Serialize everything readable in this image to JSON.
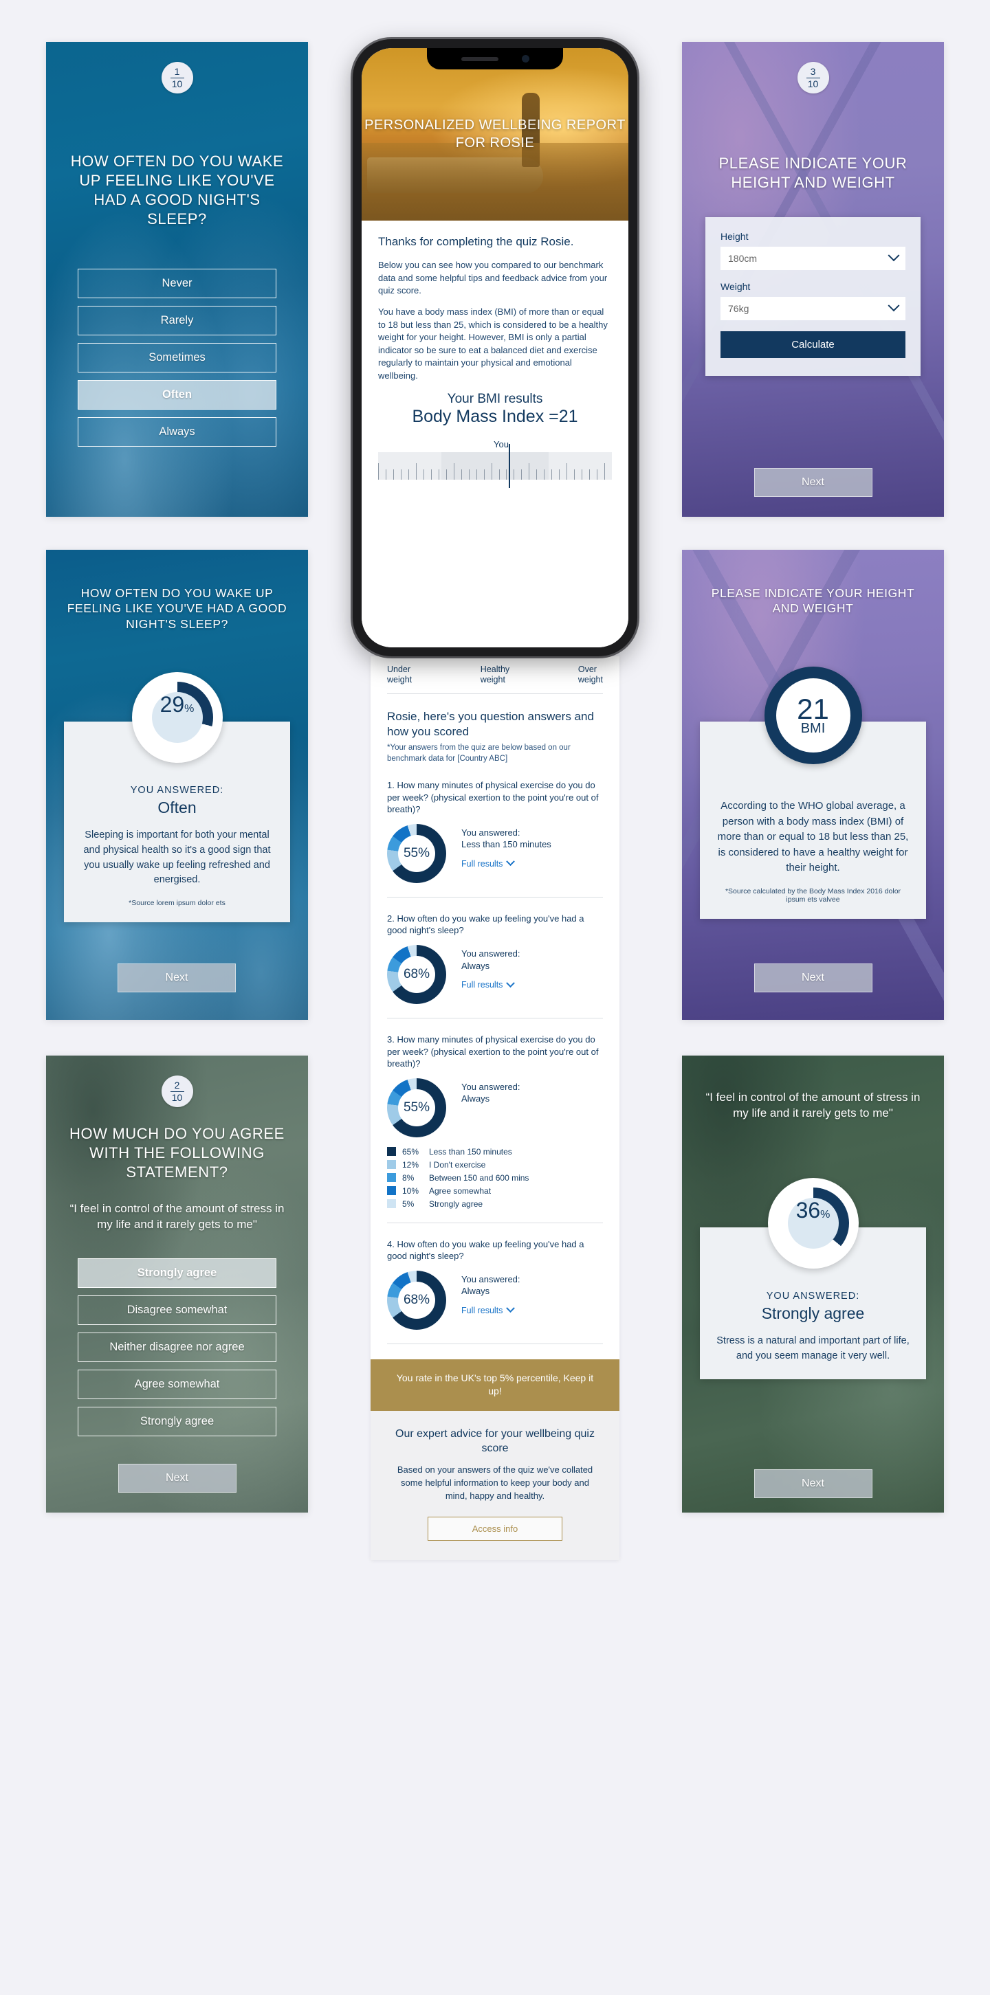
{
  "panels": {
    "q1": {
      "step_num": "1",
      "step_den": "10",
      "title": "HOW OFTEN DO YOU WAKE UP FEELING LIKE YOU'VE HAD A GOOD NIGHT'S SLEEP?",
      "options": [
        "Never",
        "Rarely",
        "Sometimes",
        "Often",
        "Always"
      ],
      "selected": "Often"
    },
    "q1_result": {
      "title": "HOW OFTEN DO YOU WAKE UP FEELING LIKE YOU'VE HAD A GOOD NIGHT'S SLEEP?",
      "percent": "29",
      "percent_symbol": "%",
      "answered_label": "YOU ANSWERED:",
      "answered_value": "Often",
      "body": "Sleeping is important for both your mental and physical health so it's a good sign that you usually wake up feeling refreshed and energised.",
      "source": "*Source lorem ipsum dolor ets",
      "next_label": "Next"
    },
    "q2": {
      "step_num": "2",
      "step_den": "10",
      "title": "HOW MUCH DO YOU AGREE WITH THE FOLLOWING STATEMENT?",
      "statement": "“I feel in control of the amount of stress in my life and it rarely gets to me\"",
      "options": [
        "Strongly agree",
        "Disagree somewhat",
        "Neither disagree nor agree",
        "Agree somewhat",
        "Strongly agree"
      ],
      "selected": "Strongly agree",
      "next_label": "Next"
    },
    "q3": {
      "step_num": "3",
      "step_den": "10",
      "title": "PLEASE INDICATE YOUR HEIGHT AND WEIGHT",
      "height_label": "Height",
      "height_value": "180cm",
      "weight_label": "Weight",
      "weight_value": "76kg",
      "calculate_label": "Calculate",
      "next_label": "Next"
    },
    "q3_result": {
      "title": "PLEASE INDICATE YOUR HEIGHT AND WEIGHT",
      "bmi_value": "21",
      "bmi_label": "BMI",
      "body": "According to the WHO global average, a person with a body mass index (BMI) of more than or equal to 18 but less than 25, is considered to have a healthy weight for their height.",
      "source": "*Source calculated by the Body Mass Index 2016 dolor ipsum ets valvee",
      "next_label": "Next"
    },
    "q2_result": {
      "statement": "“I feel in control of the amount of stress in my life and it rarely gets to me\"",
      "percent": "36",
      "percent_symbol": "%",
      "answered_label": "YOU ANSWERED:",
      "answered_value": "Strongly agree",
      "body": "Stress is a natural and important part of life, and you seem manage it very well.",
      "next_label": "Next"
    }
  },
  "phone": {
    "hero_title": "PERSONALIZED WELLBEING REPORT FOR ROSIE",
    "greeting": "Thanks for completing the quiz Rosie.",
    "para1": "Below you can see how you compared to our benchmark data and some helpful tips and feedback advice from your quiz score.",
    "para2": "You have a body mass index (BMI) of more than or equal to 18 but less than 25, which is considered to be a healthy weight for your height. However, BMI is only a partial indicator so be sure to eat a balanced diet and exercise regularly to maintain your physical and emotional wellbeing.",
    "bmi_head_1": "Your BMI results",
    "bmi_head_2": "Body Mass Index =21",
    "you_marker": "You",
    "scale_labels": [
      "Under weight",
      "Healthy weight",
      "Over weight"
    ],
    "section_head": "Rosie, here's you question answers and how you scored",
    "section_sub": "*Your answers from the quiz are below based on our benchmark data for [Country ABC]",
    "full_results_label": "Full results",
    "questions": [
      {
        "text": "1. How many minutes of physical exercise do you do per week? (physical exertion to the point you're out of breath)?",
        "percent": "55%",
        "answer_label": "You answered:",
        "answer_value": "Less than 150 minutes",
        "has_legend": false
      },
      {
        "text": "2. How often do you wake up feeling you've had a good night's sleep?",
        "percent": "68%",
        "answer_label": "You answered:",
        "answer_value": "Always",
        "has_legend": false
      },
      {
        "text": "3. How many minutes of physical exercise do you do per week? (physical exertion to the point you're out of breath)?",
        "percent": "55%",
        "answer_label": "You answered:",
        "answer_value": "Always",
        "has_legend": true
      },
      {
        "text": "4. How often do you wake up feeling you've had a good night's sleep?",
        "percent": "68%",
        "answer_label": "You answered:",
        "answer_value": "Always",
        "has_legend": false
      }
    ],
    "percentile_band": "You rate in the UK's top 5% percentile, Keep it up!",
    "advice_head": "Our expert advice for your wellbeing quiz score",
    "advice_body": "Based on your answers of the quiz we've collated some helpful information to keep your body and mind, happy and healthy.",
    "access_label": "Access info"
  },
  "chart_data": [
    {
      "type": "pie",
      "title": "Q1 sleep quality result donut",
      "categories": [
        "Often",
        "Other"
      ],
      "values": [
        29,
        71
      ],
      "labels": [
        "29%"
      ],
      "colors": [
        "#12395f",
        "#ffffff"
      ]
    },
    {
      "type": "pie",
      "title": "Q2 stress statement result donut",
      "categories": [
        "Strongly agree",
        "Other"
      ],
      "values": [
        36,
        64
      ],
      "labels": [
        "36%"
      ],
      "colors": [
        "#12395f",
        "#ffffff"
      ]
    },
    {
      "type": "pie",
      "title": "Question 1 – minutes of physical exercise per week",
      "categories": [
        "Less than 150 minutes",
        "I Don't exercise",
        "Between 150 and 600 mins",
        "Agree somewhat",
        "Strongly agree"
      ],
      "values": [
        65,
        12,
        8,
        10,
        5
      ],
      "labels": [
        "65%",
        "12%",
        "8%",
        "10%",
        "5%"
      ],
      "center_label": "55%",
      "colors": [
        "#0d3153",
        "#9fcbe8",
        "#3c9bdc",
        "#1273c6",
        "#cfe4f3"
      ]
    },
    {
      "type": "pie",
      "title": "Question 2 – good night's sleep",
      "categories": [
        "Less than 150 minutes",
        "I Don't exercise",
        "Between 150 and 600 mins",
        "Agree somewhat",
        "Strongly agree"
      ],
      "values": [
        65,
        12,
        8,
        10,
        5
      ],
      "center_label": "68%",
      "colors": [
        "#0d3153",
        "#9fcbe8",
        "#3c9bdc",
        "#1273c6",
        "#cfe4f3"
      ]
    },
    {
      "type": "pie",
      "title": "Question 3 – minutes of physical exercise per week",
      "categories": [
        "Less than 150 minutes",
        "I Don't exercise",
        "Between 150 and 600 mins",
        "Agree somewhat",
        "Strongly agree"
      ],
      "values": [
        65,
        12,
        8,
        10,
        5
      ],
      "center_label": "55%",
      "colors": [
        "#0d3153",
        "#9fcbe8",
        "#3c9bdc",
        "#1273c6",
        "#cfe4f3"
      ]
    },
    {
      "type": "pie",
      "title": "Question 4 – good night's sleep",
      "categories": [
        "Less than 150 minutes",
        "I Don't exercise",
        "Between 150 and 600 mins",
        "Agree somewhat",
        "Strongly agree"
      ],
      "values": [
        65,
        12,
        8,
        10,
        5
      ],
      "center_label": "68%",
      "colors": [
        "#0d3153",
        "#9fcbe8",
        "#3c9bdc",
        "#1273c6",
        "#cfe4f3"
      ]
    },
    {
      "type": "bar",
      "title": "BMI scale ruler",
      "categories": [
        "Under weight",
        "Healthy weight",
        "Over weight"
      ],
      "values": [
        27,
        46,
        27
      ],
      "annotations": [
        "You = 21 BMI"
      ]
    }
  ],
  "legend": [
    {
      "pct": "65%",
      "label": "Less than 150 minutes",
      "color": "#0d3153"
    },
    {
      "pct": "12%",
      "label": "I Don't exercise",
      "color": "#9fcbe8"
    },
    {
      "pct": "8%",
      "label": "Between 150 and 600 mins",
      "color": "#3c9bdc"
    },
    {
      "pct": "10%",
      "label": "Agree somewhat",
      "color": "#1273c6"
    },
    {
      "pct": "5%",
      "label": "Strongly agree",
      "color": "#cfe4f3"
    }
  ],
  "colors": {
    "brand_navy": "#12395f",
    "accent_blue": "#1a74c8",
    "gold": "#ab8f4e",
    "page_bg": "#f2f2f7"
  }
}
